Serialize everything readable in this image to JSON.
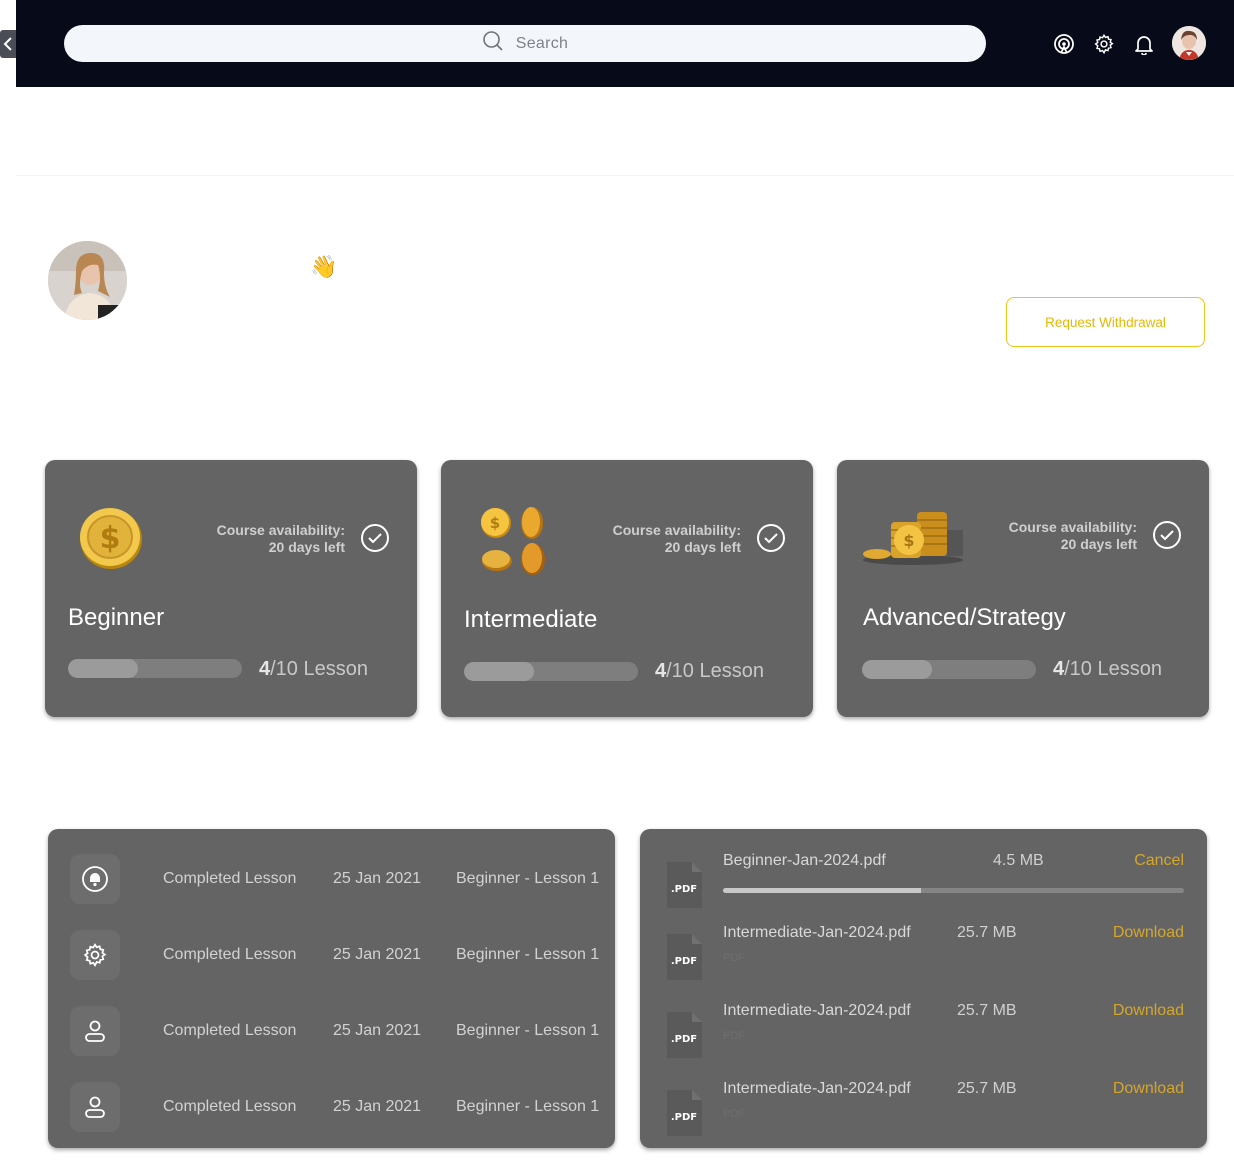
{
  "header": {
    "search_placeholder": "Search",
    "icons": [
      "toggle-code-icon",
      "search-icon",
      "broadcast-icon",
      "gear-icon",
      "bell-icon",
      "avatar"
    ]
  },
  "greeting": {
    "wave": "👋"
  },
  "withdraw_label": "Request Withdrawal",
  "colors": {
    "topbar": "#070b19",
    "card": "#646464",
    "accent": "#e6b800"
  },
  "courses": [
    {
      "title": "Beginner",
      "availability_label": "Course availability:",
      "days_left": "20 days left",
      "progress": 0.4,
      "done": "4",
      "total": "/10 Lesson"
    },
    {
      "title": "Intermediate",
      "availability_label": "Course availability:",
      "days_left": "20 days left",
      "progress": 0.4,
      "done": "4",
      "total": "/10 Lesson"
    },
    {
      "title": "Advanced/Strategy",
      "availability_label": "Course availability:",
      "days_left": "20 days left",
      "progress": 0.4,
      "done": "4",
      "total": "/10 Lesson"
    }
  ],
  "activity": [
    {
      "icon": "bell-icon",
      "action": "Completed Lesson",
      "date": "25 Jan 2021",
      "lesson": "Beginner - Lesson 1"
    },
    {
      "icon": "gear-icon",
      "action": "Completed Lesson",
      "date": "25 Jan 2021",
      "lesson": "Beginner - Lesson 1"
    },
    {
      "icon": "user-icon",
      "action": "Completed Lesson",
      "date": "25 Jan 2021",
      "lesson": "Beginner - Lesson 1"
    },
    {
      "icon": "user-icon",
      "action": "Completed Lesson",
      "date": "25 Jan 2021",
      "lesson": "Beginner - Lesson 1"
    }
  ],
  "files": [
    {
      "badge": ".PDF",
      "name": "Beginner-Jan-2024.pdf",
      "size": "4.5 MB",
      "action": "Cancel",
      "progress": 0.43
    },
    {
      "badge": ".PDF",
      "name": "Intermediate-Jan-2024.pdf",
      "size": "25.7 MB",
      "action": "Download",
      "type": "PDF"
    },
    {
      "badge": ".PDF",
      "name": "Intermediate-Jan-2024.pdf",
      "size": "25.7 MB",
      "action": "Download",
      "type": "PDF"
    },
    {
      "badge": ".PDF",
      "name": "Intermediate-Jan-2024.pdf",
      "size": "25.7 MB",
      "action": "Download",
      "type": "PDF"
    }
  ]
}
